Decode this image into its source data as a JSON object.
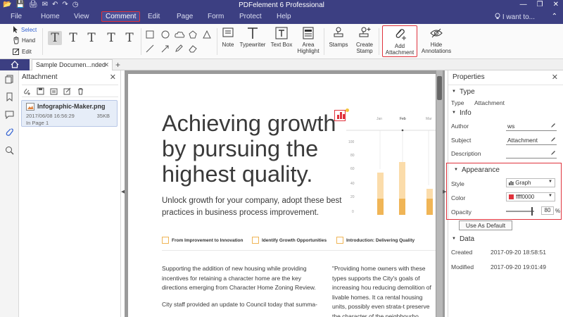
{
  "app": {
    "title": "PDFelement 6 Professional",
    "quick_access": [
      "📂",
      "💾",
      "🖨",
      "✉",
      "↶",
      "↷",
      "◷"
    ],
    "window_controls": [
      "—",
      "❐",
      "✕"
    ]
  },
  "menu": {
    "items": [
      "File",
      "Home",
      "View",
      "Comment",
      "Edit",
      "Page",
      "Form",
      "Protect",
      "Help"
    ],
    "active": "Comment",
    "search_label": "I want to...",
    "expand_label": "⌃"
  },
  "ribbon": {
    "modes": {
      "select": "Select",
      "hand": "Hand",
      "edit": "Edit"
    },
    "buttons": {
      "note": "Note",
      "typewriter": "Typewriter",
      "text_box": "Text Box",
      "area_highlight_1": "Area",
      "area_highlight_2": "Highlight",
      "stamps": "Stamps",
      "create_stamp_1": "Create",
      "create_stamp_2": "Stamp",
      "add_attachment_1": "Add",
      "add_attachment_2": "Attachment",
      "hide_annotations_1": "Hide",
      "hide_annotations_2": "Annotations"
    }
  },
  "tabs": {
    "doc_tab": "Sample Documen...nded",
    "close": "✕",
    "add": "+"
  },
  "attachment_panel": {
    "title": "Attachment",
    "close": "✕",
    "file": {
      "name": "Infographic-Maker.png",
      "date": "2017/06/08 16:56:29",
      "size": "35KB",
      "page": "In Page 1"
    }
  },
  "document": {
    "headline": "Achieving growth by pursuing the highest quality.",
    "subline": "Unlock growth for your company, adopt these best practices in business process improvement.",
    "features": [
      "From Improvement to Innovation",
      "Identify Growth Opportunities",
      "Introduction: Delivering Quality"
    ],
    "body1": "Supporting the addition of new housing while providing incentives for retaining a character home are the key directions emerging from Character Home Zoning Review.",
    "body2": "City staff provided an update to Council today that summa-",
    "body3": "\"Providing home owners with these types supports the City's goals of increasing hou reducing demolition of livable homes. It ca rental housing units, possibly even strata-t preserve the character of the neighbourho",
    "mini_chart": {
      "month_labels": [
        "Jan",
        "Feb",
        "Mar"
      ],
      "y_ticks": [
        "100",
        "80",
        "60",
        "40",
        "20",
        "0"
      ]
    }
  },
  "properties": {
    "title": "Properties",
    "close": "✕",
    "type_section": "Type",
    "type_label": "Type",
    "type_value": "Attachment",
    "info_section": "Info",
    "author_label": "Author",
    "author_value": "ws",
    "subject_label": "Subject",
    "subject_value": "Attachment",
    "description_label": "Description",
    "description_value": "",
    "appearance_section": "Appearance",
    "style_label": "Style",
    "style_value": "Graph",
    "color_label": "Color",
    "color_value": "ffff0000",
    "opacity_label": "Opacity",
    "opacity_value": "80",
    "opacity_unit": "%",
    "use_default": "Use As Default",
    "data_section": "Data",
    "created_label": "Created",
    "created_value": "2017-09-20 18:58:51",
    "modified_label": "Modified",
    "modified_value": "2017-09-20 19:01:49"
  },
  "colors": {
    "accent": "#3c3f82",
    "highlight": "#e0323c",
    "chart_light": "#fbdcaa",
    "chart_dark": "#f0b556"
  }
}
